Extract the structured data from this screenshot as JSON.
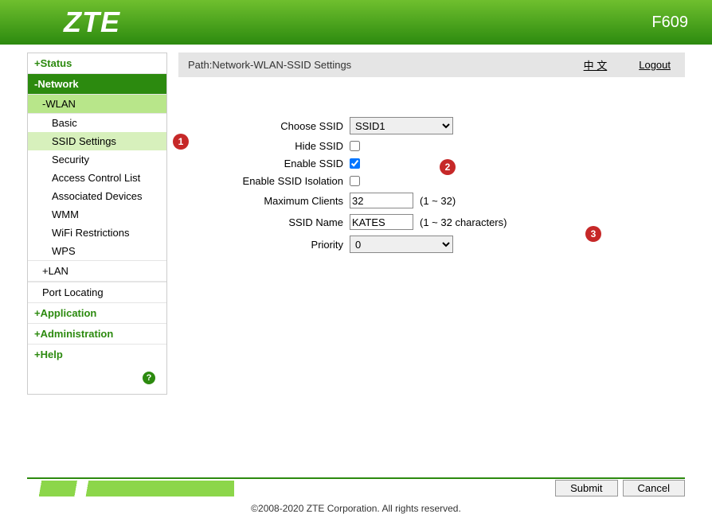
{
  "header": {
    "logo": "ZTE",
    "model": "F609"
  },
  "pathbar": {
    "path": "Path:Network-WLAN-SSID Settings",
    "lang": "中 文",
    "logout": "Logout"
  },
  "sidebar": {
    "status": "+Status",
    "network": "-Network",
    "wlan": "-WLAN",
    "leaves": [
      "Basic",
      "SSID Settings",
      "Security",
      "Access Control List",
      "Associated Devices",
      "WMM",
      "WiFi Restrictions",
      "WPS"
    ],
    "lan": "+LAN",
    "port": "Port Locating",
    "application": "+Application",
    "administration": "+Administration",
    "help": "+Help"
  },
  "form": {
    "choose_ssid": {
      "label": "Choose SSID",
      "value": "SSID1"
    },
    "hide_ssid": {
      "label": "Hide SSID",
      "checked": false
    },
    "enable_ssid": {
      "label": "Enable SSID",
      "checked": true
    },
    "isolation": {
      "label": "Enable SSID Isolation",
      "checked": false
    },
    "max_clients": {
      "label": "Maximum Clients",
      "value": "32",
      "hint": "(1 ~ 32)"
    },
    "ssid_name": {
      "label": "SSID Name",
      "value": "KATES",
      "hint": "(1 ~ 32 characters)"
    },
    "priority": {
      "label": "Priority",
      "value": "0"
    }
  },
  "buttons": {
    "submit": "Submit",
    "cancel": "Cancel"
  },
  "callouts": {
    "c1": "1",
    "c2": "2",
    "c3": "3"
  },
  "copyright": "©2008-2020 ZTE Corporation. All rights reserved."
}
